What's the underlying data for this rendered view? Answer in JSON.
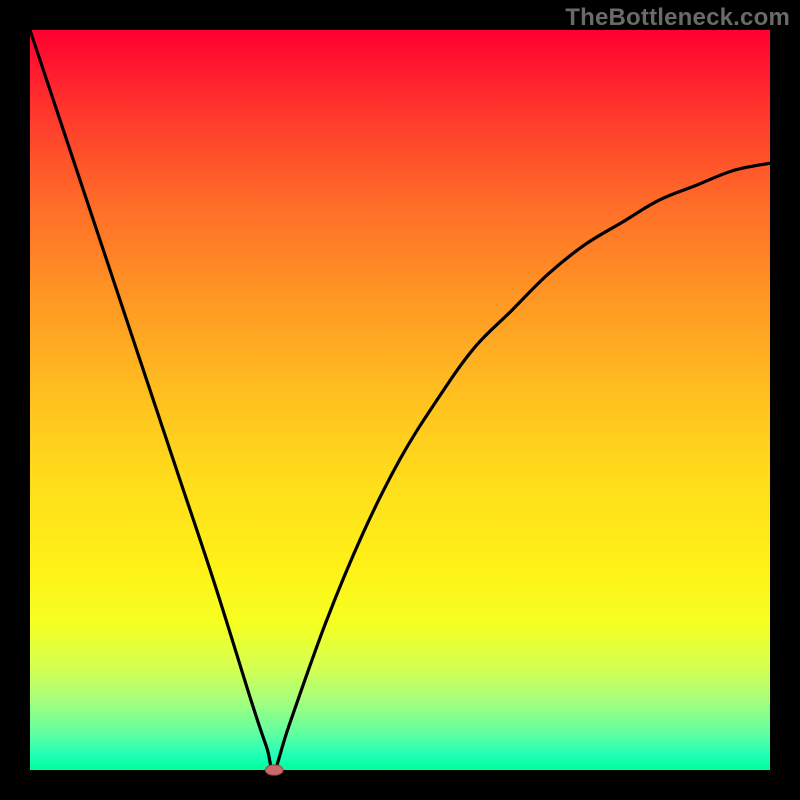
{
  "watermark": "TheBottleneck.com",
  "colors": {
    "gradient_top": "#ff0030",
    "gradient_bottom": "#00ff9a",
    "curve": "#000000",
    "dot_fill": "#c96b6b",
    "dot_stroke": "#9a4a4a",
    "frame_bg": "#000000"
  },
  "chart_data": {
    "type": "line",
    "title": "",
    "xlabel": "",
    "ylabel": "",
    "x_range": [
      0,
      100
    ],
    "y_range": [
      0,
      100
    ],
    "legend": false,
    "grid": false,
    "description": "Single V-shaped bottleneck curve on a red-to-green vertical gradient. Minimum (0) at x≈33; left branch rises linearly to ~100 at x=0; right branch rises with diminishing slope toward ~82 at x=100.",
    "series": [
      {
        "name": "bottleneck-curve",
        "x": [
          0,
          5,
          10,
          15,
          20,
          25,
          30,
          32,
          33,
          35,
          40,
          45,
          50,
          55,
          60,
          65,
          70,
          75,
          80,
          85,
          90,
          95,
          100
        ],
        "y": [
          100,
          85,
          70,
          55,
          40,
          25,
          9,
          3,
          0,
          6,
          20,
          32,
          42,
          50,
          57,
          62,
          67,
          71,
          74,
          77,
          79,
          81,
          82
        ]
      }
    ],
    "marker": {
      "x": 33,
      "y": 0,
      "shape": "ellipse",
      "rx_pct": 1.2,
      "ry_pct": 0.7
    }
  }
}
